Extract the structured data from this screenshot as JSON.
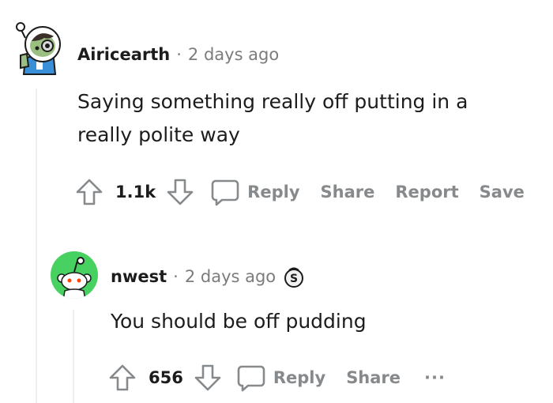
{
  "colors": {
    "text_primary": "#1c1c1c",
    "text_muted": "#7c7c7c",
    "action_gray": "#878a8c",
    "thread_line": "#edeff1",
    "reply_avatar_bg": "#46d160"
  },
  "comments": [
    {
      "username": "Airicearth",
      "separator": "·",
      "timestamp": "2 days ago",
      "body_lines": [
        "Saying something really off putting in a",
        "really polite way"
      ],
      "votes": "1.1k",
      "actions": {
        "reply": "Reply",
        "share": "Share",
        "report": "Report",
        "save": "Save"
      },
      "icons": [
        "snoo-avatar-icon",
        "upvote-arrow-icon",
        "downvote-arrow-icon",
        "comment-bubble-icon"
      ]
    },
    {
      "username": "nwest",
      "separator": "·",
      "timestamp": "2 days ago",
      "body_lines": [
        "You should be off pudding"
      ],
      "votes": "656",
      "actions": {
        "reply": "Reply",
        "share": "Share",
        "more": "···"
      },
      "icons": [
        "snoo-avatar-icon",
        "coin-award-icon",
        "upvote-arrow-icon",
        "downvote-arrow-icon",
        "comment-bubble-icon"
      ]
    }
  ]
}
